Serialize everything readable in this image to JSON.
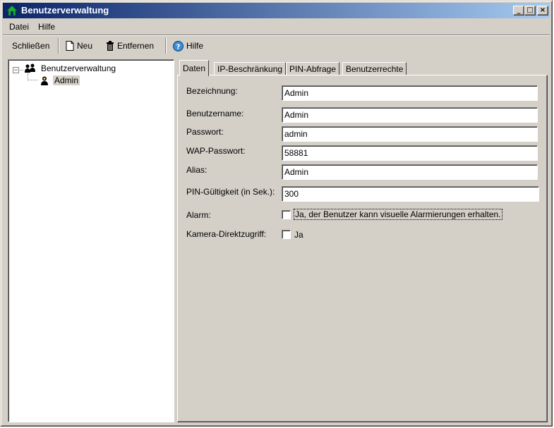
{
  "window": {
    "title": "Benutzerverwaltung",
    "controls": {
      "minimize": "_",
      "maximize": "□",
      "close": "×"
    }
  },
  "menu": {
    "items": [
      {
        "label": "Datei",
        "accel": "D"
      },
      {
        "label": "Hilfe",
        "accel": "H"
      }
    ]
  },
  "toolbar": {
    "close_label": "Schließen",
    "new_label": "Neu",
    "remove_label": "Entfernen",
    "help_label": "Hilfe"
  },
  "tree": {
    "root_label": "Benutzerverwaltung",
    "children": [
      {
        "label": "Admin",
        "selected": true
      }
    ]
  },
  "tabs": [
    {
      "label": "Daten",
      "active": true
    },
    {
      "label": "IP-Beschränkung",
      "active": false
    },
    {
      "label": "PIN-Abfrage",
      "active": false
    },
    {
      "label": "Benutzerrechte",
      "active": false
    }
  ],
  "form": {
    "bezeichnung": {
      "label": "Bezeichnung:",
      "value": "Admin"
    },
    "benutzername": {
      "label": "Benutzername:",
      "value": "Admin"
    },
    "passwort": {
      "label": "Passwort:",
      "value": "admin"
    },
    "wap_passwort": {
      "label": "WAP-Passwort:",
      "value": "58881"
    },
    "alias": {
      "label": "Alias:",
      "value": "Admin"
    },
    "pin_gueltigkeit": {
      "label": "PIN-Gültigkeit (in Sek.):",
      "value": "300"
    },
    "alarm": {
      "label": "Alarm:",
      "checkbox_text": "Ja, der Benutzer kann visuelle Alarmierungen erhalten.",
      "checked": false
    },
    "kamera": {
      "label": "Kamera-Direktzugriff:",
      "checkbox_text": "Ja",
      "checked": false
    }
  },
  "colors": {
    "titlebar_start": "#0a246a",
    "titlebar_end": "#a6caf0",
    "face": "#d4d0c8",
    "selection": "#0a246a"
  }
}
